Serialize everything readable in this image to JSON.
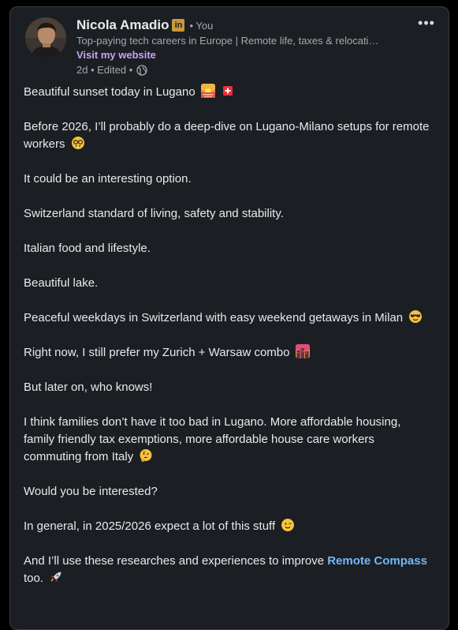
{
  "post": {
    "author": {
      "name": "Nicola Amadio",
      "badge": "in",
      "degree": "• You",
      "headline": "Top-paying tech careers in Europe | Remote life, taxes & relocati…",
      "website_label": "Visit my website",
      "timestamp": "2d • Edited •",
      "visibility_icon": "globe-icon"
    },
    "more_label": "•••",
    "paragraphs": [
      {
        "text": "Beautiful sunset today in Lugano",
        "emojis": [
          "sunset-emoji",
          "swiss-flag-emoji"
        ]
      },
      {
        "text": "Before 2026, I’ll probably do a deep-dive on Lugano-Milano setups for remote workers",
        "emojis": [
          "nerd-face-emoji"
        ]
      },
      {
        "text": "It could be an interesting option.",
        "emojis": []
      },
      {
        "text": "Switzerland standard of living, safety and stability.",
        "emojis": []
      },
      {
        "text": "Italian food and lifestyle.",
        "emojis": []
      },
      {
        "text": "Beautiful lake.",
        "emojis": []
      },
      {
        "text": "Peaceful weekdays in Switzerland with easy weekend getaways in Milan",
        "emojis": [
          "sunglasses-emoji"
        ]
      },
      {
        "text": "Right now, I still prefer my Zurich + Warsaw combo",
        "emojis": [
          "cityscape-dusk-emoji"
        ]
      },
      {
        "text": "But later on, who knows!",
        "emojis": []
      },
      {
        "text": "I think families don’t have it too bad in Lugano. More affordable housing, family friendly tax exemptions, more affordable house care workers commuting from Italy",
        "emojis": [
          "thinking-face-emoji"
        ]
      },
      {
        "text": "Would you be interested?",
        "emojis": []
      },
      {
        "text": "In general, in 2025/2026 expect a lot of this stuff",
        "emojis": [
          "winking-face-emoji"
        ]
      }
    ],
    "last_paragraph": {
      "before": "And I’ll use these researches and experiences to improve",
      "link": "Remote Compass",
      "after": "too.",
      "emoji": "rocket-emoji"
    }
  },
  "colors": {
    "background": "#000000",
    "card": "#1b1f23",
    "text": "#e9e9e9",
    "muted": "#a8a8a8",
    "website_link": "#c7a4f5",
    "hashtag_link": "#71b7fb",
    "linkedin_badge": "#c79a3a"
  }
}
